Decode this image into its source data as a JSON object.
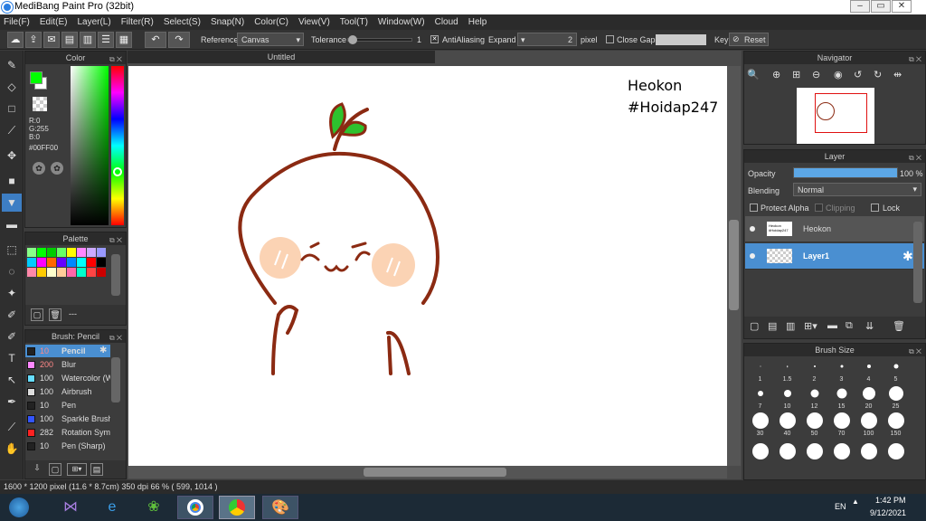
{
  "window": {
    "title": "MediBang Paint Pro (32bit)",
    "minimize": "–",
    "restore": "▭",
    "close": "✕"
  },
  "menu": [
    "File(F)",
    "Edit(E)",
    "Layer(L)",
    "Filter(R)",
    "Select(S)",
    "Snap(N)",
    "Color(C)",
    "View(V)",
    "Tool(T)",
    "Window(W)",
    "Cloud",
    "Help"
  ],
  "toolbar": {
    "reference_label": "Reference",
    "reference_value": "Canvas",
    "tolerance_label": "Tolerance",
    "tolerance_value": "1",
    "antialiasing_label": "AntiAliasing",
    "antialiasing_checked": true,
    "expand_label": "Expand",
    "expand_value": "2",
    "expand_unit": "pixel",
    "close_gaps_label": "Close Gaps",
    "close_gaps_checked": false,
    "key_label": "Key",
    "reset_label": "Reset",
    "undo_icon": "undo-icon",
    "redo_icon": "redo-icon"
  },
  "color_panel": {
    "title": "Color",
    "r": "R:0",
    "g": "G:255",
    "b": "B:0",
    "hex": "#00FF00",
    "foreground": "#00ff00",
    "background": "#ffffff"
  },
  "palette_panel": {
    "title": "Palette",
    "footer_text": "---",
    "colors": [
      "#88ff88",
      "#00ff00",
      "#00cc00",
      "#66ff66",
      "#ffff00",
      "#ff88ff",
      "#ccaaff",
      "#9999ff",
      "#00ccff",
      "#ff00ff",
      "#ff6600",
      "#6600ff",
      "#0088ff",
      "#00ffff",
      "#ff0000",
      "#000000",
      "#ff88aa",
      "#ffcc00",
      "#ffffcc",
      "#ffcc99",
      "#ff66aa",
      "#00ffcc",
      "#ff4444",
      "#cc0000"
    ]
  },
  "brush_panel": {
    "title": "Brush: Pencil",
    "items": [
      {
        "size": "10",
        "name": "Pencil",
        "color": "#222222",
        "selected": true
      },
      {
        "size": "200",
        "name": "Blur",
        "color": "#ff88ff"
      },
      {
        "size": "100",
        "name": "Watercolor (W",
        "color": "#66ddff"
      },
      {
        "size": "100",
        "name": "Airbrush",
        "color": "#dddddd"
      },
      {
        "size": "10",
        "name": "Pen",
        "color": "#222222"
      },
      {
        "size": "100",
        "name": "Sparkle Brush",
        "color": "#3355ff"
      },
      {
        "size": "282",
        "name": "Rotation Sym",
        "color": "#ff2222"
      },
      {
        "size": "10",
        "name": "Pen (Sharp)",
        "color": "#222222"
      }
    ]
  },
  "document": {
    "tab": "Untitled",
    "watermark_line1": "Heokon",
    "watermark_line2": "#Hoidap247"
  },
  "navigator": {
    "title": "Navigator"
  },
  "layer_panel": {
    "title": "Layer",
    "opacity_label": "Opacity",
    "opacity_value": "100 %",
    "opacity_fraction": 1.0,
    "blending_label": "Blending",
    "blending_value": "Normal",
    "protect_alpha": "Protect Alpha",
    "clipping": "Clipping",
    "lock": "Lock",
    "layers": [
      {
        "name": "Heokon",
        "thumb_text": "Heokon #Hoidap247",
        "selected": false
      },
      {
        "name": "Layer1",
        "selected": true
      }
    ]
  },
  "brush_size_panel": {
    "title": "Brush Size",
    "sizes": [
      "1",
      "1.5",
      "2",
      "3",
      "4",
      "5",
      "7",
      "10",
      "12",
      "15",
      "20",
      "25",
      "30",
      "40",
      "50",
      "70",
      "100",
      "150",
      "",
      "",
      "",
      "",
      "",
      ""
    ]
  },
  "status": {
    "text": "1600 * 1200 pixel   (11.6 * 8.7cm)   350 dpi   66 %   ( 599, 1014 )"
  },
  "taskbar": {
    "lang": "EN",
    "time": "1:42 PM",
    "date": "9/12/2021"
  }
}
